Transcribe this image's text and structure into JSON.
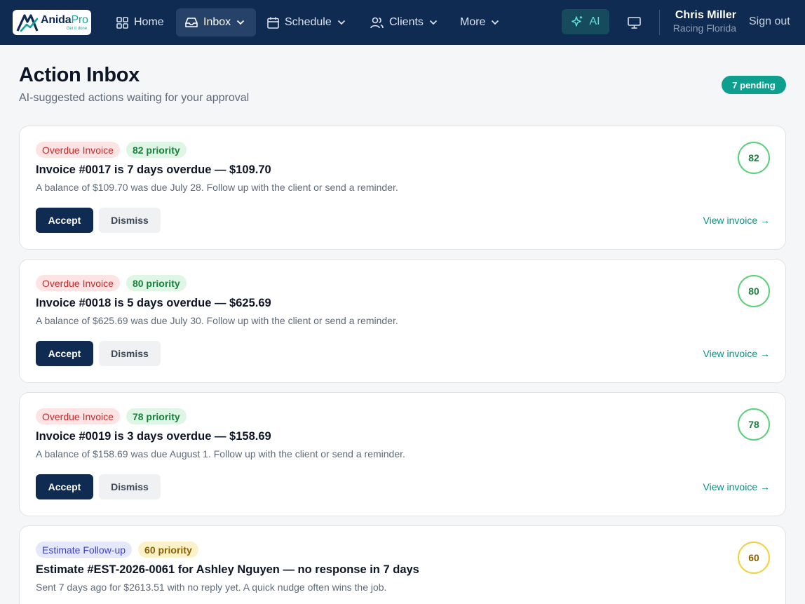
{
  "brand": {
    "name_main": "Anida",
    "name_suffix": "Pro",
    "tagline": "Get it done."
  },
  "nav": {
    "home": "Home",
    "inbox": "Inbox",
    "schedule": "Schedule",
    "clients": "Clients",
    "more": "More",
    "ai": "AI",
    "sign_out": "Sign out"
  },
  "user": {
    "name": "Chris Miller",
    "org": "Racing Florida"
  },
  "page": {
    "title": "Action Inbox",
    "subtitle": "AI-suggested actions waiting for your approval",
    "pending": "7 pending"
  },
  "colors": {
    "nav_bg": "#0f2b52",
    "accent_teal": "#0e9f8e",
    "primary_button": "#0f2b52",
    "danger": "#c62828",
    "success": "#1a7f3b",
    "warning": "#8a6100"
  },
  "cards": [
    {
      "type": "Overdue Invoice",
      "priority": "82 priority",
      "score": "82",
      "title": "Invoice #0017 is 7 days overdue — $109.70",
      "desc": "A balance of $109.70 was due July 28. Follow up with the client or send a reminder.",
      "accept": "Accept",
      "dismiss": "Dismiss",
      "link": "View invoice →"
    },
    {
      "type": "Overdue Invoice",
      "priority": "80 priority",
      "score": "80",
      "title": "Invoice #0018 is 5 days overdue — $625.69",
      "desc": "A balance of $625.69 was due July 30. Follow up with the client or send a reminder.",
      "accept": "Accept",
      "dismiss": "Dismiss",
      "link": "View invoice →"
    },
    {
      "type": "Overdue Invoice",
      "priority": "78 priority",
      "score": "78",
      "title": "Invoice #0019 is 3 days overdue — $158.69",
      "desc": "A balance of $158.69 was due August 1. Follow up with the client or send a reminder.",
      "accept": "Accept",
      "dismiss": "Dismiss",
      "link": "View invoice →"
    },
    {
      "type": "Estimate Follow-up",
      "priority": "60 priority",
      "score": "60",
      "title": "Estimate #EST-2026-0061 for Ashley Nguyen — no response in 7 days",
      "desc": "Sent 7 days ago for $2613.51 with no reply yet. A quick nudge often wins the job."
    }
  ]
}
